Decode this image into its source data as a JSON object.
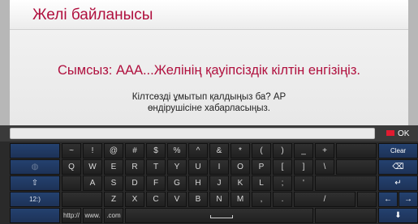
{
  "dialog": {
    "title": "Желі байланысы",
    "main_message": "Сымсыз: AAA...Желінің қауіпсіздік кілтін енгізіңіз.",
    "sub_message": "Кілтсөзді ұмытып қалдыңыз ба? AP өндірушісіне хабарласыңыз."
  },
  "input": {
    "value": ""
  },
  "ok_label": "OK",
  "keys": {
    "row1": [
      "~",
      "!",
      "@",
      "#",
      "$",
      "%",
      "^",
      "&",
      "*",
      "(",
      ")",
      "_",
      "+"
    ],
    "row2": [
      "Q",
      "W",
      "E",
      "R",
      "T",
      "Y",
      "U",
      "I",
      "O",
      "P",
      "[",
      "]",
      "\\"
    ],
    "row3": [
      "A",
      "S",
      "D",
      "F",
      "G",
      "H",
      "J",
      "K",
      "L",
      ";",
      "'"
    ],
    "row4": [
      "Z",
      "X",
      "C",
      "V",
      "B",
      "N",
      "M",
      ",",
      ".",
      "/"
    ],
    "row5": [
      "http://",
      "www.",
      ".com"
    ]
  },
  "side_keys": {
    "globe": "◍",
    "shift": "⇧",
    "mode": "12:)"
  },
  "right_keys": {
    "clear": "Clear",
    "backspace": "⌫",
    "enter": "↵",
    "left": "←",
    "right": "→",
    "down": "⬇"
  }
}
